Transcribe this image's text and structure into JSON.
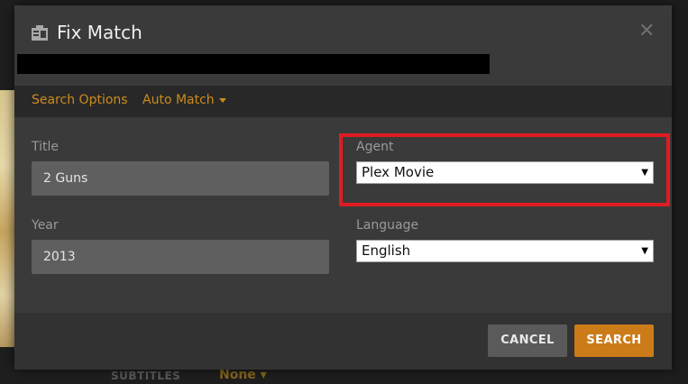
{
  "dialog": {
    "title": "Fix Match",
    "title_icon": "id-card-icon",
    "close_icon": "close-icon",
    "close_glyph": "✕"
  },
  "tabs": {
    "search_options": "Search Options",
    "auto_match": "Auto Match"
  },
  "form": {
    "title_label": "Title",
    "title_value": "2 Guns",
    "year_label": "Year",
    "year_value": "2013",
    "agent_label": "Agent",
    "agent_value": "Plex Movie",
    "language_label": "Language",
    "language_value": "English"
  },
  "buttons": {
    "cancel": "CANCEL",
    "search": "SEARCH"
  },
  "background": {
    "subtitles_label": "SUBTITLES",
    "subtitles_value": "None"
  },
  "colors": {
    "accent": "#cc8b1d",
    "search_button": "#cc7b19",
    "highlight": "#e11b22"
  }
}
